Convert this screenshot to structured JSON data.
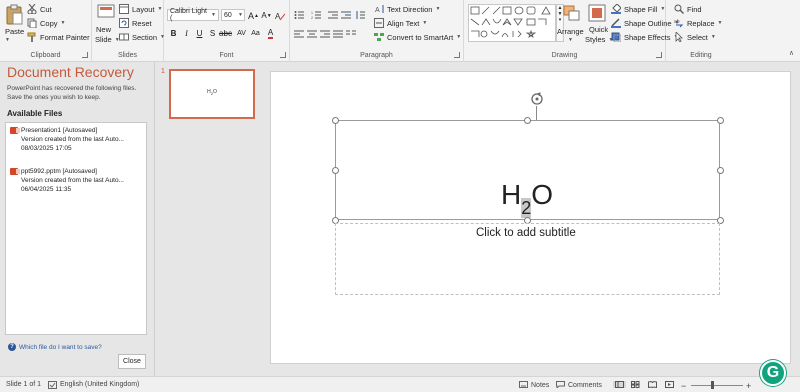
{
  "ribbon": {
    "clipboard": {
      "label": "Clipboard",
      "paste": "Paste",
      "cut": "Cut",
      "copy": "Copy",
      "format_painter": "Format Painter"
    },
    "slides": {
      "label": "Slides",
      "new_slide": "New",
      "new_slide2": "Slide",
      "layout": "Layout",
      "reset": "Reset",
      "section": "Section"
    },
    "font": {
      "label": "Font",
      "font_name": "Calibri Light (",
      "font_size": "60"
    },
    "paragraph": {
      "label": "Paragraph",
      "text_direction": "Text Direction",
      "align_text": "Align Text",
      "convert_smartart": "Convert to SmartArt"
    },
    "drawing": {
      "label": "Drawing",
      "arrange": "Arrange",
      "quick_styles": "Quick",
      "quick_styles2": "Styles",
      "shape_fill": "Shape Fill",
      "shape_outline": "Shape Outline",
      "shape_effects": "Shape Effects"
    },
    "editing": {
      "label": "Editing",
      "find": "Find",
      "replace": "Replace",
      "select": "Select"
    }
  },
  "recovery": {
    "title": "Document Recovery",
    "description": "PowerPoint has recovered the following files. Save the ones you wish to keep.",
    "available_files": "Available Files",
    "files": [
      {
        "name": "Presentation1  [Autosaved]",
        "detail": "Version created from the last Auto...",
        "date": "08/03/2025 17:05"
      },
      {
        "name": "ppt5992.pptm  [Autosaved]",
        "detail": "Version created from the last Auto...",
        "date": "06/04/2025 11:35"
      }
    ],
    "help_link": "Which file do I want to save?",
    "close": "Close"
  },
  "thumbnails": {
    "number": "1",
    "text": "H2O"
  },
  "slide": {
    "title_main": "H",
    "title_sub": "2",
    "title_end": "O",
    "subtitle_placeholder": "Click to add subtitle"
  },
  "status": {
    "slide_info": "Slide 1 of 1",
    "language": "English (United Kingdom)",
    "notes": "Notes",
    "comments": "Comments"
  },
  "colors": {
    "accent": "#d36a4b",
    "grammarly": "#12a37e"
  }
}
